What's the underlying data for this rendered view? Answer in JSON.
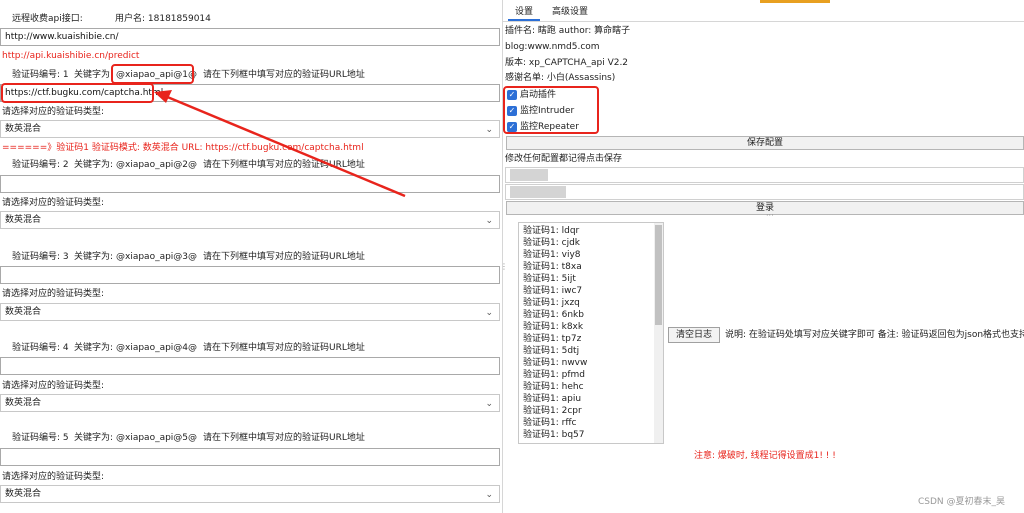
{
  "left": {
    "header_label": "远程收费api接口:",
    "username_label": "用户名: 18181859014",
    "api_url_value": "http://www.kuaishibie.cn/",
    "predict_url": "http://api.kuaishibie.cn/predict",
    "captcha_1": {
      "number_label": "验证码编号: 1",
      "keyword_label": "关键字为:",
      "keyword": "@xiapao_api@1@",
      "hint": "请在下列框中填写对应的验证码URL地址",
      "url_value": "https://ctf.bugku.com/captcha.html",
      "type_label": "请选择对应的验证码类型:",
      "type_value": "数英混合",
      "status": "======》验证码1    验证码模式: 数英混合    URL: https://ctf.bugku.com/captcha.html"
    },
    "captcha_2": {
      "number_label": "验证码编号: 2",
      "keyword_label": "关键字为:",
      "keyword": "@xiapao_api@2@",
      "hint": "请在下列框中填写对应的验证码URL地址",
      "type_label": "请选择对应的验证码类型:",
      "type_value": "数英混合"
    },
    "captcha_3": {
      "number_label": "验证码编号: 3",
      "keyword_label": "关键字为:",
      "keyword": "@xiapao_api@3@",
      "hint": "请在下列框中填写对应的验证码URL地址",
      "type_label": "请选择对应的验证码类型:",
      "type_value": "数英混合"
    },
    "captcha_4": {
      "number_label": "验证码编号: 4",
      "keyword_label": "关键字为:",
      "keyword": "@xiapao_api@4@",
      "hint": "请在下列框中填写对应的验证码URL地址",
      "type_label": "请选择对应的验证码类型:",
      "type_value": "数英混合"
    },
    "captcha_5": {
      "number_label": "验证码编号: 5",
      "keyword_label": "关键字为:",
      "keyword": "@xiapao_api@5@",
      "hint": "请在下列框中填写对应的验证码URL地址",
      "type_label": "请选择对应的验证码类型:",
      "type_value": "数英混合"
    }
  },
  "right": {
    "tabs": [
      "设置",
      "高级设置"
    ],
    "plugin_info": "插件名: 瞎跑 author: 算命瞎子",
    "blog": "blog:www.nmd5.com",
    "version": "版本: xp_CAPTCHA_api V2.2",
    "thanks": "感谢名单: 小白(Assassins)",
    "checkboxes": [
      "启动插件",
      "监控Intruder",
      "监控Repeater"
    ],
    "save_button": "保存配置",
    "save_hint": "修改任何配置都记得点击保存",
    "login_button": "登录",
    "clear_log_button": "清空日志",
    "description": "说明: 在验证码处填写对应关键字即可  备注: 验证码返回包为json格式也支持",
    "warning": "注意: 爆破时, 线程记得设置成1! ! !",
    "log_items": [
      "验证码1: ldqr",
      "验证码1: cjdk",
      "验证码1: viy8",
      "验证码1: t8xa",
      "验证码1: 5ijt",
      "验证码1: iwc7",
      "验证码1: jxzq",
      "验证码1: 6nkb",
      "验证码1: k8xk",
      "验证码1: tp7z",
      "验证码1: 5dtj",
      "验证码1: nwvw",
      "验证码1: pfmd",
      "验证码1: hehc",
      "验证码1: apiu",
      "验证码1: 2cpr",
      "验证码1: rffc",
      "验证码1: bq57"
    ]
  },
  "watermark": "CSDN @夏初春末_昊",
  "colors": {
    "accent_red": "#e8241c",
    "checkbox_blue": "#2c6fd6",
    "tab_orange": "#e8a020"
  }
}
